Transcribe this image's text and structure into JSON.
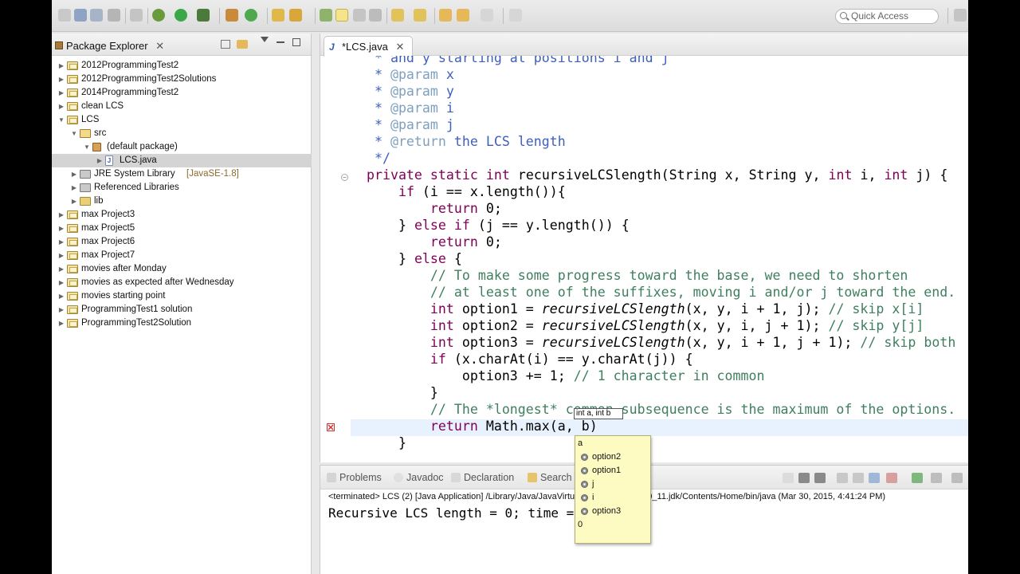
{
  "toolbar": {
    "quick_access_placeholder": "Quick Access"
  },
  "package_explorer": {
    "title": "Package Explorer",
    "close_glyph": "✕",
    "items": [
      {
        "label": "2012ProgrammingTest2",
        "icon": "project-icon",
        "arrow": "▶"
      },
      {
        "label": "2012ProgrammingTest2Solutions",
        "icon": "project-icon",
        "arrow": "▶"
      },
      {
        "label": "2014ProgrammingTest2",
        "icon": "project-icon",
        "arrow": "▶"
      },
      {
        "label": "clean LCS",
        "icon": "project-icon",
        "arrow": "▶"
      },
      {
        "label": "LCS",
        "icon": "project-icon",
        "arrow": "▼"
      },
      {
        "label": "src",
        "icon": "source-folder-icon",
        "arrow": "▼"
      },
      {
        "label": "(default package)",
        "icon": "package-icon",
        "arrow": "▼"
      },
      {
        "label": "LCS.java",
        "icon": "java-file-icon",
        "arrow": "▶"
      },
      {
        "label": "JRE System Library",
        "suffix": "[JavaSE-1.8]",
        "icon": "library-icon",
        "arrow": "▶"
      },
      {
        "label": "Referenced Libraries",
        "icon": "library-icon",
        "arrow": "▶"
      },
      {
        "label": "lib",
        "icon": "folder-icon",
        "arrow": "▶"
      },
      {
        "label": "max Project3",
        "icon": "project-icon",
        "arrow": "▶"
      },
      {
        "label": "max Project5",
        "icon": "project-icon",
        "arrow": "▶"
      },
      {
        "label": "max Project6",
        "icon": "project-icon",
        "arrow": "▶"
      },
      {
        "label": "max Project7",
        "icon": "project-icon",
        "arrow": "▶"
      },
      {
        "label": "movies after Monday",
        "icon": "project-icon",
        "arrow": "▶"
      },
      {
        "label": "movies as expected after Wednesday",
        "icon": "project-icon",
        "arrow": "▶"
      },
      {
        "label": "movies starting point",
        "icon": "project-icon",
        "arrow": "▶"
      },
      {
        "label": "ProgrammingTest1 solution",
        "icon": "project-icon",
        "arrow": "▶"
      },
      {
        "label": "ProgrammingTest2Solution",
        "icon": "project-icon",
        "arrow": "▶"
      }
    ]
  },
  "editor": {
    "tab_label": "*LCS.java",
    "tab_glyph": "J",
    "close_glyph": "✕",
    "lines": [
      [
        {
          "t": "   * ",
          "c": "jd"
        },
        {
          "t": "and y starting at positions i and j",
          "c": "jd"
        }
      ],
      [
        {
          "t": "   * ",
          "c": "jd"
        },
        {
          "t": "@param",
          "c": "tag"
        },
        {
          "t": " x",
          "c": "jd"
        }
      ],
      [
        {
          "t": "   * ",
          "c": "jd"
        },
        {
          "t": "@param",
          "c": "tag"
        },
        {
          "t": " y",
          "c": "jd"
        }
      ],
      [
        {
          "t": "   * ",
          "c": "jd"
        },
        {
          "t": "@param",
          "c": "tag"
        },
        {
          "t": " i",
          "c": "jd"
        }
      ],
      [
        {
          "t": "   * ",
          "c": "jd"
        },
        {
          "t": "@param",
          "c": "tag"
        },
        {
          "t": " j",
          "c": "jd"
        }
      ],
      [
        {
          "t": "   * ",
          "c": "jd"
        },
        {
          "t": "@return",
          "c": "tag"
        },
        {
          "t": " the LCS length",
          "c": "jd"
        }
      ],
      [
        {
          "t": "   */",
          "c": "jd"
        }
      ],
      [
        {
          "t": "  "
        },
        {
          "t": "private",
          "c": "kw"
        },
        {
          "t": " "
        },
        {
          "t": "static",
          "c": "kw"
        },
        {
          "t": " "
        },
        {
          "t": "int",
          "c": "kw"
        },
        {
          "t": " recursiveLCSlength(String x, String y, "
        },
        {
          "t": "int",
          "c": "kw"
        },
        {
          "t": " i, "
        },
        {
          "t": "int",
          "c": "kw"
        },
        {
          "t": " j) {"
        }
      ],
      [
        {
          "t": "      "
        },
        {
          "t": "if",
          "c": "kw"
        },
        {
          "t": " (i == x.length()){"
        }
      ],
      [
        {
          "t": "          "
        },
        {
          "t": "return",
          "c": "kw"
        },
        {
          "t": " 0;"
        }
      ],
      [
        {
          "t": "      } "
        },
        {
          "t": "else",
          "c": "kw"
        },
        {
          "t": " "
        },
        {
          "t": "if",
          "c": "kw"
        },
        {
          "t": " (j == y.length()) {"
        }
      ],
      [
        {
          "t": "          "
        },
        {
          "t": "return",
          "c": "kw"
        },
        {
          "t": " 0;"
        }
      ],
      [
        {
          "t": "      } "
        },
        {
          "t": "else",
          "c": "kw"
        },
        {
          "t": " {"
        }
      ],
      [
        {
          "t": "          "
        },
        {
          "t": "// To make some progress toward the base, we need to shorten",
          "c": "cm"
        }
      ],
      [
        {
          "t": "          "
        },
        {
          "t": "// at least one of the suffixes, moving i and/or j toward the end.",
          "c": "cm"
        }
      ],
      [
        {
          "t": "          "
        },
        {
          "t": "int",
          "c": "kw"
        },
        {
          "t": " option1 = "
        },
        {
          "t": "recursiveLCSlength",
          "c": "it"
        },
        {
          "t": "(x, y, i + 1, j); "
        },
        {
          "t": "// skip x[i]",
          "c": "cm"
        }
      ],
      [
        {
          "t": "          "
        },
        {
          "t": "int",
          "c": "kw"
        },
        {
          "t": " option2 = "
        },
        {
          "t": "recursiveLCSlength",
          "c": "it"
        },
        {
          "t": "(x, y, i, j + 1); "
        },
        {
          "t": "// skip y[j]",
          "c": "cm"
        }
      ],
      [
        {
          "t": "          "
        },
        {
          "t": "int",
          "c": "kw"
        },
        {
          "t": " option3 = "
        },
        {
          "t": "recursiveLCSlength",
          "c": "it"
        },
        {
          "t": "(x, y, i + 1, j + 1); "
        },
        {
          "t": "// skip both",
          "c": "cm"
        }
      ],
      [
        {
          "t": "          "
        },
        {
          "t": "if",
          "c": "kw"
        },
        {
          "t": " (x.charAt(i) == y.charAt(j)) {"
        }
      ],
      [
        {
          "t": "              option3 += 1; "
        },
        {
          "t": "// 1 character in common",
          "c": "cm"
        }
      ],
      [
        {
          "t": "          }"
        }
      ],
      [
        {
          "t": "          "
        },
        {
          "t": "// The *longest* common subsequence is the maximum of the options.",
          "c": "cm"
        }
      ],
      [
        {
          "t": "          "
        },
        {
          "t": "return",
          "c": "kw"
        },
        {
          "t": " Math.max(a, b)"
        }
      ],
      [
        {
          "t": "      }"
        }
      ]
    ],
    "param_hint": "int a, int b"
  },
  "completion": {
    "items": [
      {
        "label": "a",
        "kind": "plain"
      },
      {
        "label": "option2",
        "kind": "local"
      },
      {
        "label": "option1",
        "kind": "local"
      },
      {
        "label": "j",
        "kind": "local"
      },
      {
        "label": "i",
        "kind": "local"
      },
      {
        "label": "option3",
        "kind": "local"
      },
      {
        "label": "0",
        "kind": "plain"
      }
    ]
  },
  "console": {
    "tabs": [
      "Problems",
      "Javadoc",
      "Declaration",
      "Search"
    ],
    "status": "<terminated> LCS (2) [Java Application] /Library/Java/JavaVirtualMachines/jdk1.8.0_11.jdk/Contents/Home/bin/java (Mar 30, 2015, 4:41:24 PM)",
    "output": "Recursive LCS length = 0; time = 0"
  }
}
